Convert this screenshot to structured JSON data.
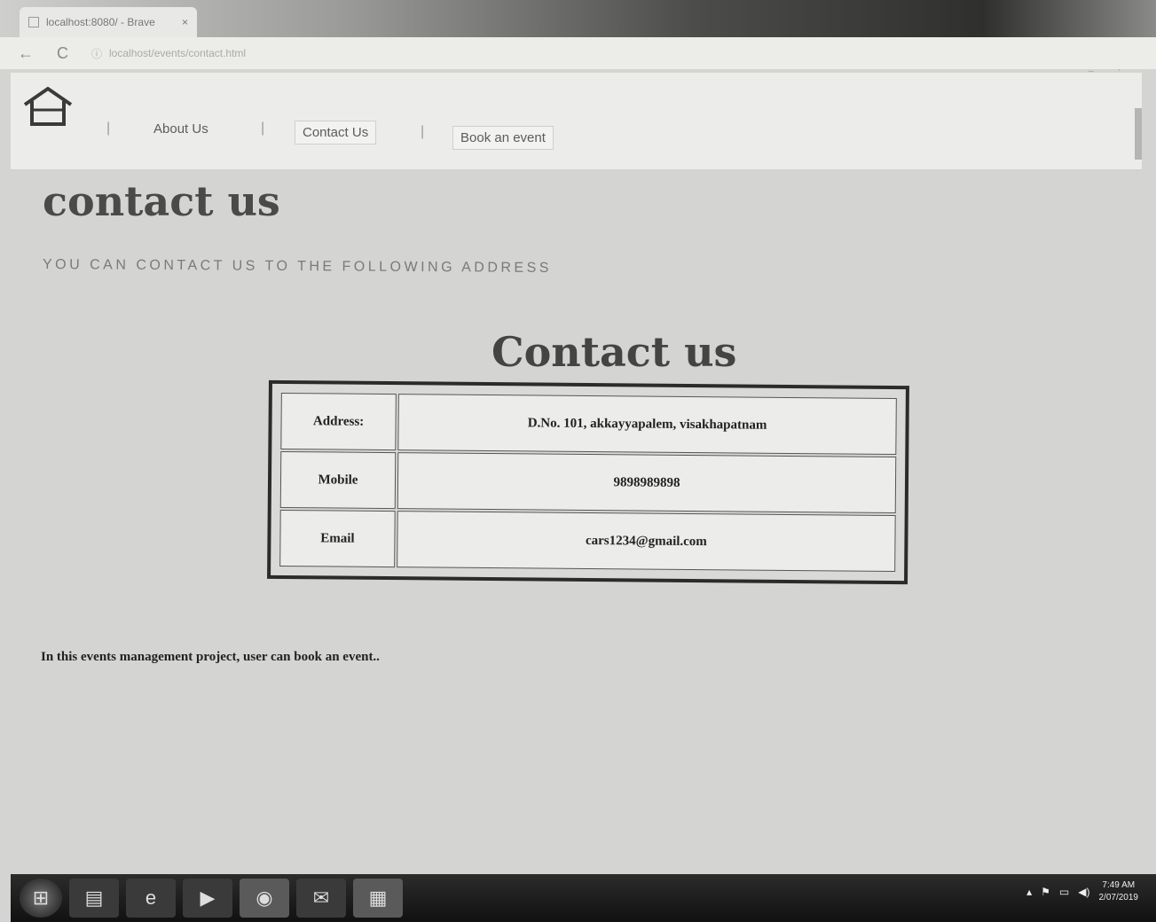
{
  "browser": {
    "tab_title": "localhost:8080/ - Brave",
    "tab_close": "×",
    "back": "←",
    "reload": "C",
    "url": "localhost/events/contact.html",
    "menu": "≡ ⋮"
  },
  "nav": {
    "home_icon": "home-icon",
    "separator": "|",
    "links": [
      "About Us",
      "Contact Us",
      "Book an event"
    ]
  },
  "main": {
    "heading": "contact us",
    "subheading": "YOU CAN CONTACT US TO THE FOLLOWING ADDRESS",
    "table_title": "Contact us",
    "rows": [
      {
        "label": "Address:",
        "value": "D.No. 101, akkayyapalem, visakhapatnam"
      },
      {
        "label": "Mobile",
        "value": "9898989898"
      },
      {
        "label": "Email",
        "value": "cars1234@gmail.com"
      }
    ],
    "footer": "In this events management project, user can book an event.."
  },
  "taskbar": {
    "icons": [
      "start-orb-icon",
      "folder-icon",
      "internet-explorer-icon",
      "media-player-icon",
      "chrome-icon",
      "mail-icon",
      "document-icon"
    ],
    "time": "7:49 AM",
    "date": "2/07/2019"
  },
  "colors": {
    "page_background": "#d4d4d2",
    "table_border": "#2b2b2b"
  }
}
